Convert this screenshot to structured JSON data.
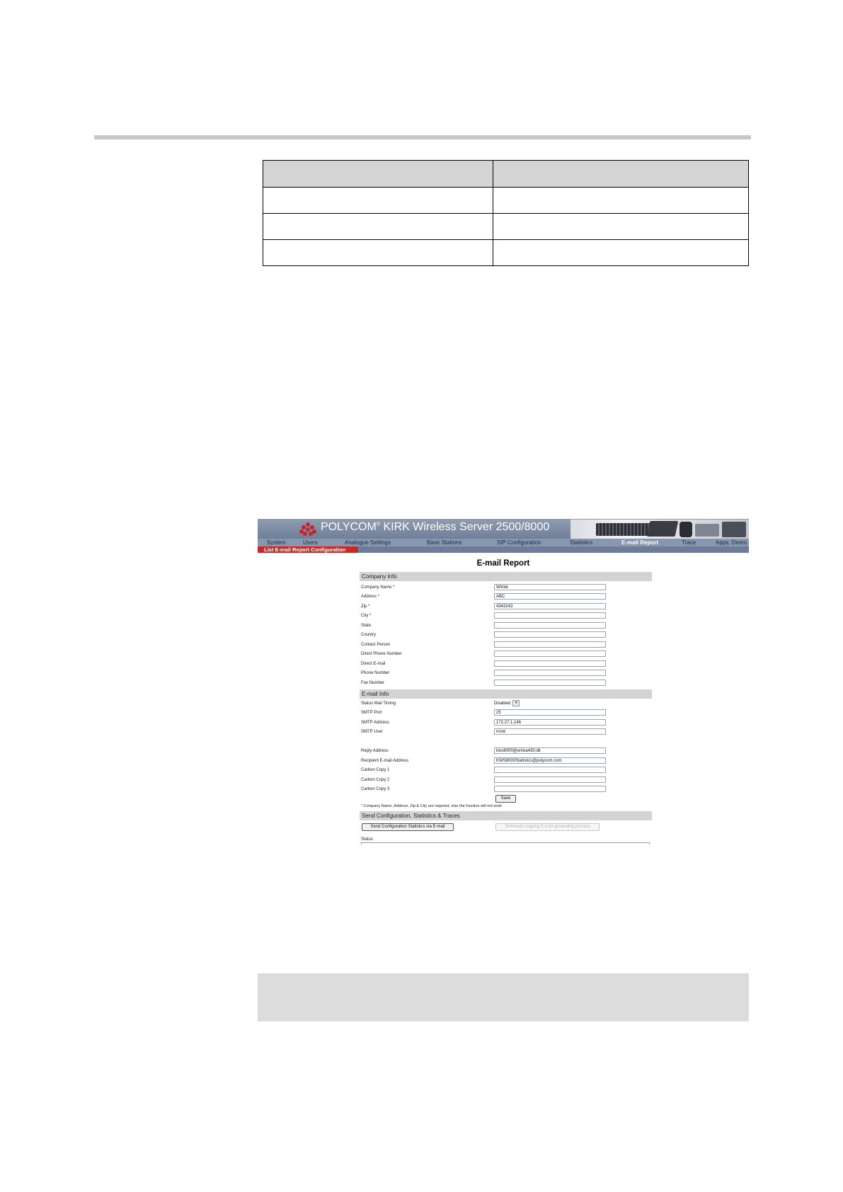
{
  "email_report_screen": {
    "brand": {
      "name": "POLYCOM",
      "mark": "®",
      "product": " KIRK Wireless Server 2500/8000"
    },
    "nav": [
      "System",
      "Users",
      "Analogue Settings",
      "Base Stations",
      "SIP Configuration",
      "Statistics",
      "E-mail Report",
      "Trace",
      "Apps. Demo"
    ],
    "nav_active": "E-mail Report",
    "subtab": "List E-mail Report Configuration",
    "title": "E-mail Report",
    "company_info": {
      "heading": "Company Info",
      "fields": [
        {
          "label": "Company Name *",
          "value": "Wirtek"
        },
        {
          "label": "Address *",
          "value": "ABC"
        },
        {
          "label": "Zip *",
          "value": "4343243"
        },
        {
          "label": "City *",
          "value": ""
        },
        {
          "label": "State",
          "value": ""
        },
        {
          "label": "Country",
          "value": ""
        },
        {
          "label": "Contact Person",
          "value": ""
        },
        {
          "label": "Direct Phone Number",
          "value": ""
        },
        {
          "label": "Direct E-mail",
          "value": ""
        },
        {
          "label": "Phone Number",
          "value": ""
        },
        {
          "label": "Fax Number",
          "value": ""
        }
      ]
    },
    "email_info": {
      "heading": "E-mail Info",
      "status_mail_timing": {
        "label": "Status Mail Timing",
        "value": "Disabled"
      },
      "smtp_port": {
        "label": "SMTP Port",
        "value": "25"
      },
      "smtp_address": {
        "label": "SMTP Address",
        "value": "172.27.1.146"
      },
      "smtp_user": {
        "label": "SMTP User",
        "value": "none"
      },
      "reply_address": {
        "label": "Reply Address",
        "value": "kws8000@emea430.dk"
      },
      "recipient": {
        "label": "Recipient E-mail Address",
        "value": "KWS8000Statistics@polycom.com"
      },
      "cc1": {
        "label": "Carbon Copy 1",
        "value": ""
      },
      "cc2": {
        "label": "Carbon Copy 2",
        "value": ""
      },
      "cc3": {
        "label": "Carbon Copy 3",
        "value": ""
      },
      "save": "Save",
      "note": "* Company Name, Address, Zip & City are required, else the function will not work"
    },
    "send": {
      "heading": "Send Configuration, Statistics & Traces",
      "send_button": "Send Configuration Statistics via E-mail",
      "terminate_button": "Terminate ongoing E-mail generating process",
      "status_label": "Status"
    }
  }
}
